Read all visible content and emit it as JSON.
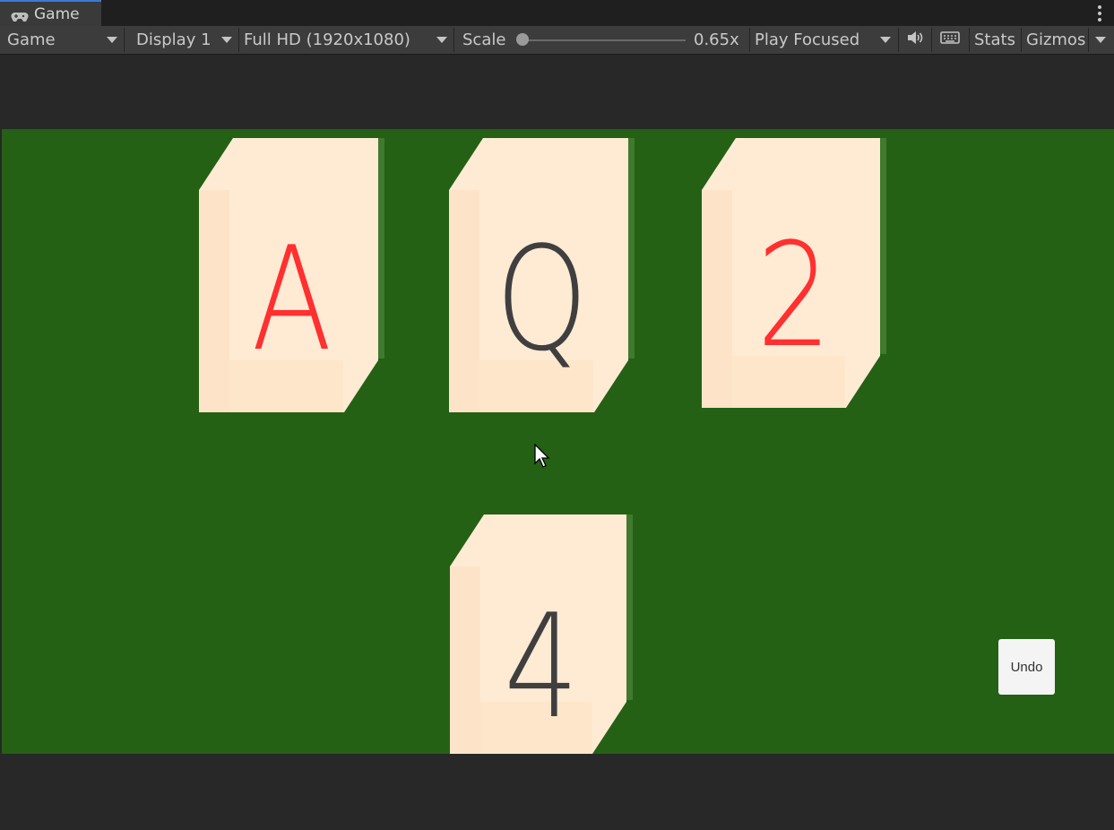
{
  "tab": {
    "label": "Game",
    "icon": "gamepad-icon"
  },
  "toolbar": {
    "view_mode": "Game",
    "display": "Display 1",
    "resolution": "Full HD (1920x1080)",
    "scale_label": "Scale",
    "scale_value": "0.65x",
    "play_mode": "Play Focused",
    "audio_icon": "speaker-icon",
    "keyboard_icon": "keyboard-icon",
    "stats_label": "Stats",
    "gizmos_label": "Gizmos"
  },
  "colors": {
    "table_green": "#246115",
    "card_face": "#ffead3",
    "red_rank": "#ff3030",
    "black_rank": "#3f3f3f"
  },
  "cards": [
    {
      "rank": "A",
      "color": "red"
    },
    {
      "rank": "Q",
      "color": "black"
    },
    {
      "rank": "2",
      "color": "red"
    },
    {
      "rank": "4",
      "color": "black"
    }
  ],
  "undo_label": "Undo"
}
